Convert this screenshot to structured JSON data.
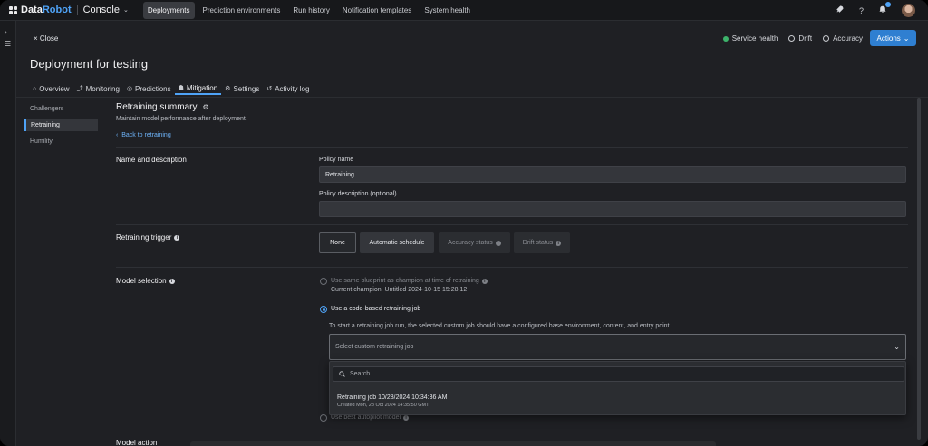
{
  "topnav": {
    "logo": {
      "brand_a": "Data",
      "brand_b": "Robot"
    },
    "console_label": "Console",
    "tabs": [
      {
        "label": "Deployments",
        "active": true
      },
      {
        "label": "Prediction environments",
        "active": false
      },
      {
        "label": "Run history",
        "active": false
      },
      {
        "label": "Notification templates",
        "active": false
      },
      {
        "label": "System health",
        "active": false
      }
    ],
    "icons": [
      "rocket-icon",
      "help-icon",
      "bell-icon",
      "avatar"
    ]
  },
  "header": {
    "close_label": "Close",
    "title": "Deployment for testing",
    "status": {
      "service_health": "Service health",
      "drift": "Drift",
      "accuracy": "Accuracy"
    },
    "actions_label": "Actions"
  },
  "subtabs": [
    {
      "label": "Overview",
      "icon": "home-icon",
      "active": false
    },
    {
      "label": "Monitoring",
      "icon": "chart-icon",
      "active": false
    },
    {
      "label": "Predictions",
      "icon": "predictions-icon",
      "active": false
    },
    {
      "label": "Mitigation",
      "icon": "trophy-icon",
      "active": true
    },
    {
      "label": "Settings",
      "icon": "gear-icon",
      "active": false
    },
    {
      "label": "Activity log",
      "icon": "history-icon",
      "active": false
    }
  ],
  "sidenav": [
    {
      "label": "Challengers",
      "active": false
    },
    {
      "label": "Retraining",
      "active": true
    },
    {
      "label": "Humility",
      "active": false
    }
  ],
  "summary": {
    "title": "Retraining summary",
    "subtitle": "Maintain model performance after deployment.",
    "back_link": "Back to retraining"
  },
  "name_section": {
    "label": "Name and description",
    "policy_name_label": "Policy name",
    "policy_name_value": "Retraining",
    "policy_desc_label": "Policy description (optional)",
    "policy_desc_value": ""
  },
  "trigger_section": {
    "label": "Retraining trigger",
    "buttons": [
      {
        "label": "None",
        "state": "selected"
      },
      {
        "label": "Automatic schedule",
        "state": "normal"
      },
      {
        "label": "Accuracy status",
        "state": "disabled"
      },
      {
        "label": "Drift status",
        "state": "disabled"
      }
    ]
  },
  "model_section": {
    "label": "Model selection",
    "opt_same_blueprint": "Use same blueprint as champion at time of retraining",
    "current_champion": "Current champion: Untitled 2024-10-15 15:28:12",
    "opt_code_based": "Use a code-based retraining job",
    "hint": "To start a retraining job run, the selected custom job should have a configured base environment, content, and entry point.",
    "select_placeholder": "Select custom retraining job",
    "search_placeholder": "Search",
    "job_title": "Retraining job 10/28/2024 10:34:36 AM",
    "job_created": "Created Mon, 28 Oct 2024 14:35:50 GMT",
    "opt_autopilot": "Use best autopilot model"
  },
  "bottom_peek": "Model action"
}
